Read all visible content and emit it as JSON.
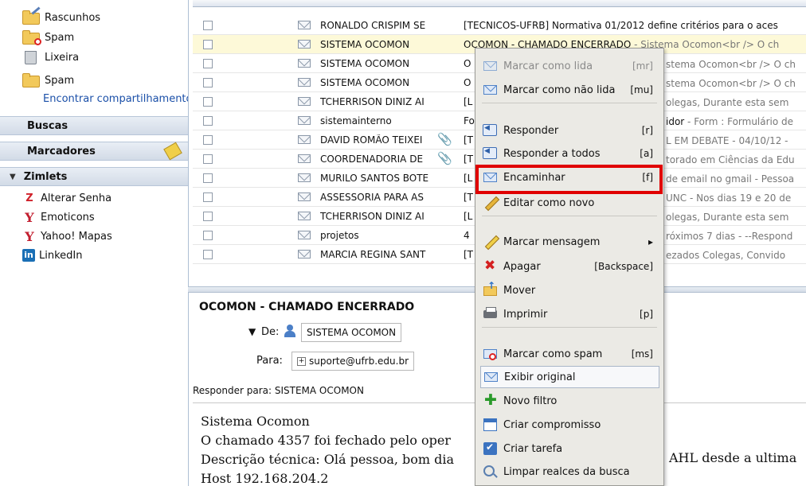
{
  "sidebar": {
    "folders": [
      {
        "label": "Rascunhos",
        "icon": "drafts-folder-icon"
      },
      {
        "label": "Spam",
        "icon": "spam-folder-icon"
      },
      {
        "label": "Lixeira",
        "icon": "trash-icon"
      },
      {
        "label": "Spam",
        "icon": "folder-icon"
      }
    ],
    "find_shares": "Encontrar compartilhamento",
    "sections": {
      "searches": "Buscas",
      "tags": "Marcadores",
      "zimlets": "Zimlets"
    },
    "zimlets": [
      {
        "label": "Alterar Senha",
        "icon": "z-icon"
      },
      {
        "label": "Emoticons",
        "icon": "yahoo-y-icon"
      },
      {
        "label": "Yahoo! Mapas",
        "icon": "yahoo-y-icon"
      },
      {
        "label": "LinkedIn",
        "icon": "linkedin-icon"
      }
    ]
  },
  "message_list": {
    "rows": [
      {
        "from": "RONALDO CRISPIM SE",
        "subject": "[TECNICOS-UFRB] Normativa 01/2012 define critérios para o aces",
        "fragment": "",
        "attach": false
      },
      {
        "from": "SISTEMA OCOMON",
        "subject": "OCOMON - CHAMADO ENCERRADO",
        "fragment": " - Sistema Ocomon<br /> O ch",
        "attach": false
      },
      {
        "from": "SISTEMA OCOMON",
        "subject": "O",
        "fragment": "",
        "attach": false
      },
      {
        "from": "SISTEMA OCOMON",
        "subject": "O",
        "fragment": "",
        "attach": false
      },
      {
        "from": "TCHERRISON DINIZ AI",
        "subject": "[L",
        "fragment": "",
        "attach": false
      },
      {
        "from": "sistemainterno",
        "subject": "Fo",
        "fragment": "",
        "attach": false
      },
      {
        "from": "DAVID ROMÃO TEIXEI",
        "subject": "[T",
        "fragment": "",
        "attach": true
      },
      {
        "from": "COORDENADORIA DE",
        "subject": "[T",
        "fragment": "",
        "attach": true
      },
      {
        "from": "MURILO SANTOS BOTE",
        "subject": "[L",
        "fragment": "",
        "attach": false
      },
      {
        "from": "ASSESSORIA PARA AS",
        "subject": "[T",
        "fragment": "",
        "attach": false
      },
      {
        "from": "TCHERRISON DINIZ AI",
        "subject": "[L",
        "fragment": "",
        "attach": false
      },
      {
        "from": "projetos",
        "subject": "4",
        "fragment": "",
        "attach": false
      },
      {
        "from": "MARCIA REGINA SANT",
        "subject": "[T",
        "fragment": "",
        "attach": false
      }
    ],
    "behind_menu": [
      {
        "text": "stema Ocomon<br /> O ch",
        "bold": ""
      },
      {
        "text": "stema Ocomon<br /> O ch",
        "bold": ""
      },
      {
        "text": "olegas, Durante esta sem",
        "bold": ""
      },
      {
        "text": " - Form : Formulário de",
        "bold": "idor"
      },
      {
        "text": "L EM DEBATE - 04/10/12 -",
        "bold": ""
      },
      {
        "text": "torado em Ciências da Edu",
        "bold": ""
      },
      {
        "text": " de email no gmail - Pessoa",
        "bold": ""
      },
      {
        "text": "UNC - Nos dias 19 e 20 de",
        "bold": ""
      },
      {
        "text": "olegas, Durante esta sem",
        "bold": ""
      },
      {
        "text": "róximos 7 dias - --Respond",
        "bold": ""
      },
      {
        "text": "ezados Colegas, Convido",
        "bold": ""
      }
    ]
  },
  "reading_pane": {
    "subject": "OCOMON - CHAMADO ENCERRADO",
    "from_label": "De:",
    "from_value": "SISTEMA OCOMON",
    "to_label": "Para:",
    "to_value": "suporte@ufrb.edu.br",
    "reply_to": "Responder para: SISTEMA OCOMON",
    "body_lines": [
      "Sistema Ocomon",
      "O chamado 4357 foi fechado pelo oper",
      "Descrição técnica: Olá pessoa, bom dia",
      "Host 192.168.204.2"
    ],
    "body_right": "AHL desde a ultima"
  },
  "context_menu": {
    "items": [
      {
        "label": "Marcar como lida",
        "shortcut": "[mr]",
        "icon": "envelope-open-icon",
        "disabled": true
      },
      {
        "label": "Marcar como não lida",
        "shortcut": "[mu]",
        "icon": "envelope-icon",
        "disabled": false
      },
      {
        "label": "Responder",
        "shortcut": "[r]",
        "icon": "reply-icon",
        "disabled": false
      },
      {
        "label": "Responder a todos",
        "shortcut": "[a]",
        "icon": "reply-all-icon",
        "disabled": false
      },
      {
        "label": "Encaminhar",
        "shortcut": "[f]",
        "icon": "forward-icon",
        "disabled": false
      },
      {
        "label": "Editar como novo",
        "shortcut": "",
        "icon": "pencil-icon",
        "disabled": false
      },
      {
        "label": "Marcar mensagem",
        "shortcut": "▸",
        "icon": "tag-icon",
        "disabled": false
      },
      {
        "label": "Apagar",
        "shortcut": "[Backspace]",
        "icon": "delete-icon",
        "disabled": false
      },
      {
        "label": "Mover",
        "shortcut": "",
        "icon": "move-folder-icon",
        "disabled": false
      },
      {
        "label": "Imprimir",
        "shortcut": "[p]",
        "icon": "printer-icon",
        "disabled": false
      },
      {
        "label": "Marcar como spam",
        "shortcut": "[ms]",
        "icon": "spam-icon",
        "disabled": false
      },
      {
        "label": "Exibir original",
        "shortcut": "",
        "icon": "envelope-icon",
        "disabled": false
      },
      {
        "label": "Novo filtro",
        "shortcut": "",
        "icon": "plus-icon",
        "disabled": false
      },
      {
        "label": "Criar compromisso",
        "shortcut": "",
        "icon": "calendar-icon",
        "disabled": false
      },
      {
        "label": "Criar tarefa",
        "shortcut": "",
        "icon": "task-icon",
        "disabled": false
      },
      {
        "label": "Limpar realces da busca",
        "shortcut": "",
        "icon": "magnifier-icon",
        "disabled": false
      }
    ]
  },
  "colors": {
    "highlight_box": "#e00000",
    "link": "#1a4fa8",
    "selected_row": "#fdf9d8"
  }
}
